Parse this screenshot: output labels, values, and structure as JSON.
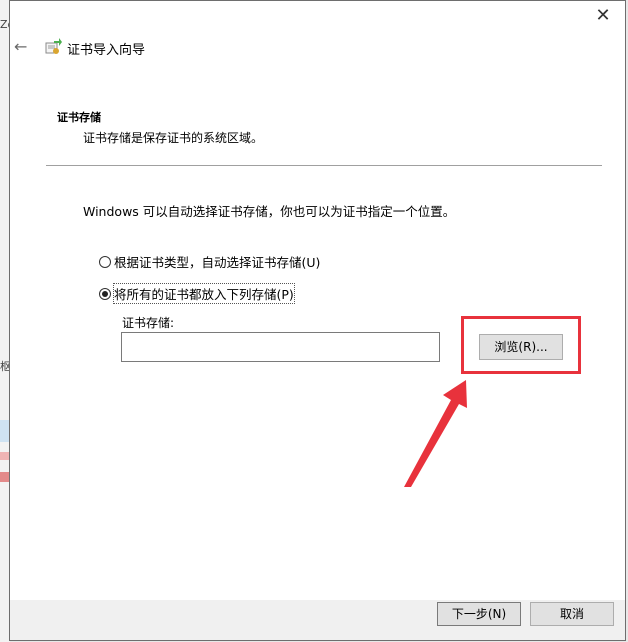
{
  "window": {
    "close_glyph": "✕",
    "back_glyph": "←",
    "title": "证书导入向导"
  },
  "section": {
    "title": "证书存储",
    "description": "证书存储是保存证书的系统区域。"
  },
  "intro_text": "Windows 可以自动选择证书存储，你也可以为证书指定一个位置。",
  "options": [
    {
      "label": "根据证书类型，自动选择证书存储(U)",
      "checked": false
    },
    {
      "label": "将所有的证书都放入下列存储(P)",
      "checked": true
    }
  ],
  "store": {
    "label": "证书存储:",
    "value": ""
  },
  "buttons": {
    "browse": "浏览(R)...",
    "next": "下一步(N)",
    "cancel": "取消"
  },
  "background_fragments": [
    "Zo",
    "枢"
  ],
  "colors": {
    "highlight": "#e8323c",
    "button_bg": "#e1e1e1"
  }
}
